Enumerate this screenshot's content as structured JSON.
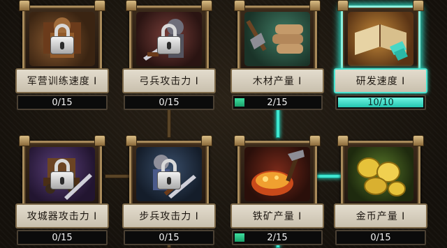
{
  "cards": [
    {
      "label": "军营训练速度 I",
      "progress_text": "0/15",
      "progress": 0.0,
      "locked": true,
      "icon": "training-dummy-icon"
    },
    {
      "label": "弓兵攻击力 I",
      "progress_text": "0/15",
      "progress": 0.0,
      "locked": true,
      "icon": "archer-sword-icon"
    },
    {
      "label": "木材产量 I",
      "progress_text": "2/15",
      "progress": 0.133,
      "locked": false,
      "icon": "wood-axe-icon"
    },
    {
      "label": "研发速度 I",
      "progress_text": "10/10",
      "progress": 1.0,
      "locked": false,
      "icon": "research-book-icon"
    },
    {
      "label": "攻城器攻击力 I",
      "progress_text": "0/15",
      "progress": 0.0,
      "locked": true,
      "icon": "siege-sword-icon"
    },
    {
      "label": "步兵攻击力 I",
      "progress_text": "0/15",
      "progress": 0.0,
      "locked": true,
      "icon": "infantry-sword-icon"
    },
    {
      "label": "铁矿产量 I",
      "progress_text": "2/15",
      "progress": 0.133,
      "locked": false,
      "icon": "iron-ore-icon"
    },
    {
      "label": "金币产量 I",
      "progress_text": "0/15",
      "progress": 0.0,
      "locked": false,
      "icon": "gold-coins-icon"
    }
  ],
  "colors": {
    "accent": "#3fe6d0",
    "progress_fill": "#3fe0a0",
    "connector": "#5a4426"
  }
}
